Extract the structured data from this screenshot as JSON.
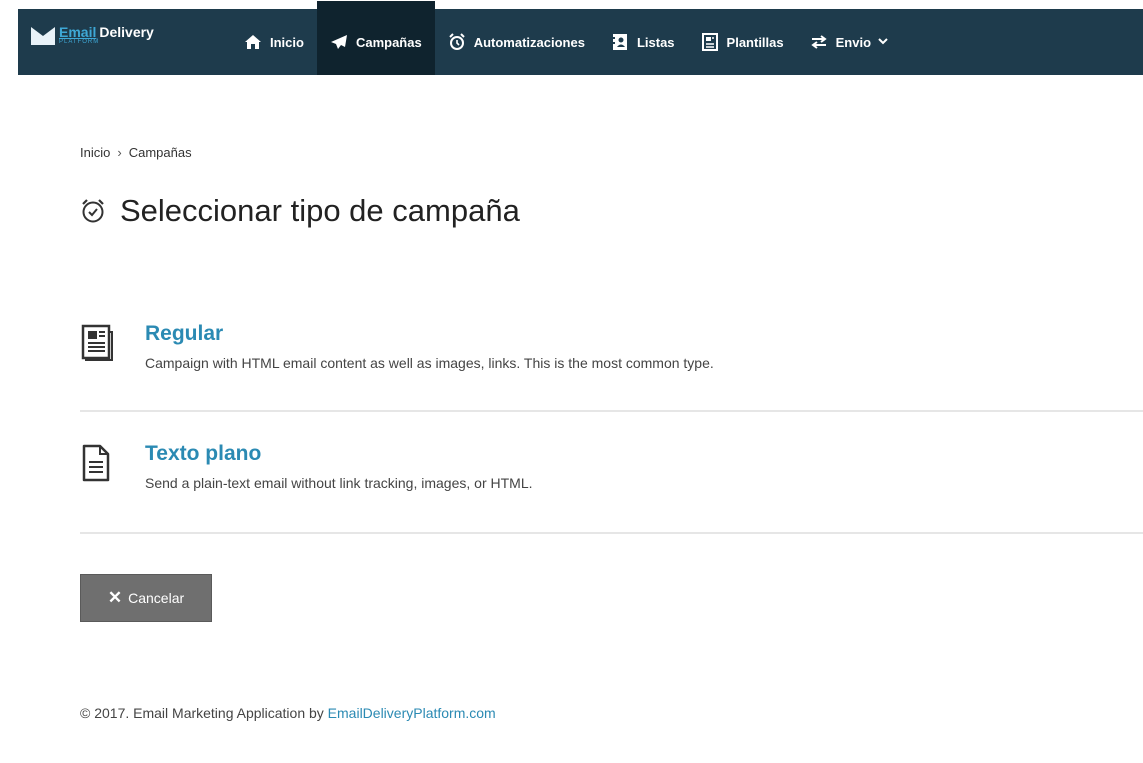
{
  "brand": {
    "email": "Email",
    "delivery": "Delivery",
    "sub": "PLATFORM"
  },
  "nav": [
    {
      "label": "Inicio",
      "icon": "home-icon"
    },
    {
      "label": "Campañas",
      "icon": "paper-plane-icon",
      "active": true
    },
    {
      "label": "Automatizaciones",
      "icon": "alarm-clock-icon"
    },
    {
      "label": "Listas",
      "icon": "address-book-icon"
    },
    {
      "label": "Plantillas",
      "icon": "newspaper-icon"
    },
    {
      "label": "Envio",
      "icon": "exchange-icon",
      "dropdown": true
    }
  ],
  "breadcrumb": {
    "home": "Inicio",
    "separator": "›",
    "current": "Campañas"
  },
  "page": {
    "title": "Seleccionar tipo de campaña",
    "title_icon": "alarm-clock-icon"
  },
  "options": [
    {
      "title": "Regular",
      "description": "Campaign with HTML email content as well as images, links. This is the most common type.",
      "icon": "newspaper-icon"
    },
    {
      "title": "Texto plano",
      "description": "Send a plain-text email without link tracking, images, or HTML.",
      "icon": "text-file-icon"
    }
  ],
  "cancel": {
    "label": "Cancelar",
    "icon": "close-icon"
  },
  "footer": {
    "text": "© 2017. Email Marketing Application by",
    "link": "EmailDeliveryPlatform.com"
  },
  "colors": {
    "nav_bg": "#1e3b4c",
    "nav_active_bg": "#0f232e",
    "accent": "#2b8ab3",
    "button_bg": "#6f6f6f"
  }
}
